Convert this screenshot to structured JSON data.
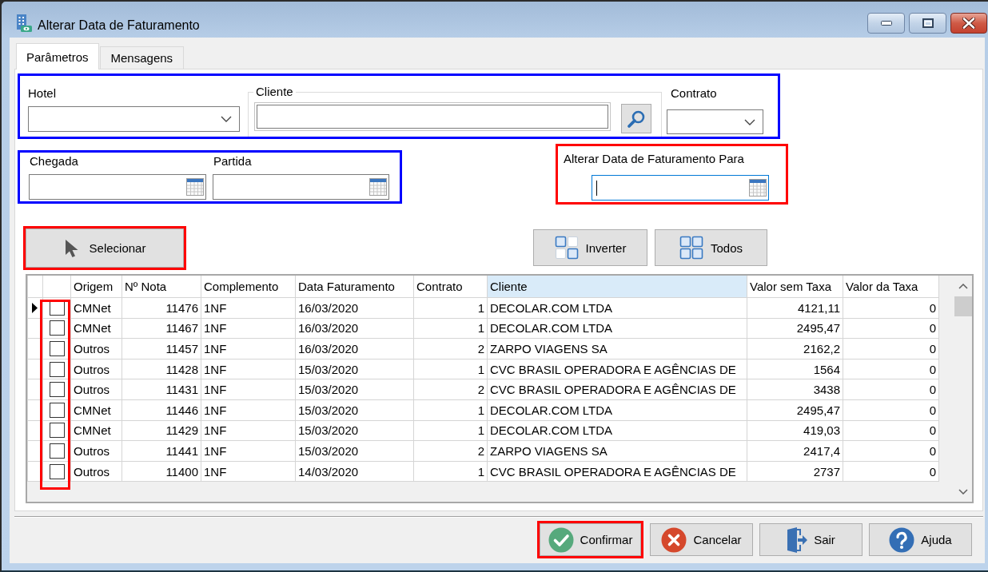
{
  "window": {
    "title": "Alterar Data de Faturamento"
  },
  "tabs": [
    {
      "label": "Parâmetros",
      "selected": true
    },
    {
      "label": "Mensagens",
      "selected": false
    }
  ],
  "filters": {
    "highlight": {
      "color": "#0000ff"
    },
    "hotel": {
      "label": "Hotel"
    },
    "cliente": {
      "label": "Cliente"
    },
    "contrato": {
      "label": "Contrato"
    }
  },
  "dates": {
    "highlight": {
      "color": "#0000ff"
    },
    "chegada": {
      "label": "Chegada"
    },
    "partida": {
      "label": "Partida"
    }
  },
  "billing_date": {
    "highlight": {
      "color": "#ff0000"
    },
    "label": "Alterar Data de Faturamento Para",
    "focused": true
  },
  "select_button": {
    "label": "Selecionar",
    "highlight": {
      "color": "#ff0000"
    }
  },
  "toggle_buttons": [
    {
      "label": "Inverter",
      "kind": "invert"
    },
    {
      "label": "Todos",
      "kind": "all"
    }
  ],
  "grid": {
    "checkbox_highlight": {
      "color": "#ff0000"
    },
    "columns": [
      {
        "label": "Origem",
        "kind": "text",
        "highlighted": false
      },
      {
        "label": "Nº Nota",
        "kind": "number",
        "highlighted": false
      },
      {
        "label": "Complemento",
        "kind": "text",
        "highlighted": false
      },
      {
        "label": "Data Faturamento",
        "kind": "text",
        "highlighted": false
      },
      {
        "label": "Contrato",
        "kind": "number",
        "highlighted": false
      },
      {
        "label": "Cliente",
        "kind": "text",
        "highlighted": true
      },
      {
        "label": "Valor sem Taxa",
        "kind": "number",
        "highlighted": false
      },
      {
        "label": "Valor da Taxa",
        "kind": "number",
        "highlighted": false
      }
    ],
    "rows": [
      {
        "current": true,
        "checked": false,
        "cells": [
          "CMNet",
          "11476",
          "1NF",
          "16/03/2020",
          "1",
          "DECOLAR.COM LTDA",
          "4121,11",
          "0"
        ]
      },
      {
        "current": false,
        "checked": false,
        "cells": [
          "CMNet",
          "11467",
          "1NF",
          "16/03/2020",
          "1",
          "DECOLAR.COM LTDA",
          "2495,47",
          "0"
        ]
      },
      {
        "current": false,
        "checked": false,
        "cells": [
          "Outros",
          "11457",
          "1NF",
          "16/03/2020",
          "2",
          "ZARPO VIAGENS SA",
          "2162,2",
          "0"
        ]
      },
      {
        "current": false,
        "checked": false,
        "cells": [
          "Outros",
          "11428",
          "1NF",
          "15/03/2020",
          "1",
          "CVC BRASIL OPERADORA E AGÊNCIAS DE",
          "1564",
          "0"
        ]
      },
      {
        "current": false,
        "checked": false,
        "cells": [
          "Outros",
          "11431",
          "1NF",
          "15/03/2020",
          "2",
          "CVC BRASIL OPERADORA E AGÊNCIAS DE",
          "3438",
          "0"
        ]
      },
      {
        "current": false,
        "checked": false,
        "cells": [
          "CMNet",
          "11446",
          "1NF",
          "15/03/2020",
          "1",
          "DECOLAR.COM LTDA",
          "2495,47",
          "0"
        ]
      },
      {
        "current": false,
        "checked": false,
        "cells": [
          "CMNet",
          "11429",
          "1NF",
          "15/03/2020",
          "1",
          "DECOLAR.COM LTDA",
          "419,03",
          "0"
        ]
      },
      {
        "current": false,
        "checked": false,
        "cells": [
          "Outros",
          "11441",
          "1NF",
          "15/03/2020",
          "2",
          "ZARPO VIAGENS SA",
          "2417,4",
          "0"
        ]
      },
      {
        "current": false,
        "checked": false,
        "cells": [
          "Outros",
          "11400",
          "1NF",
          "14/03/2020",
          "1",
          "CVC BRASIL OPERADORA E AGÊNCIAS DE",
          "2737",
          "0"
        ]
      }
    ]
  },
  "footer_buttons": [
    {
      "label": "Confirmar",
      "kind": "confirm",
      "highlight": {
        "color": "#ff0000"
      }
    },
    {
      "label": "Cancelar",
      "kind": "cancel"
    },
    {
      "label": "Sair",
      "kind": "exit"
    },
    {
      "label": "Ajuda",
      "kind": "help"
    }
  ]
}
